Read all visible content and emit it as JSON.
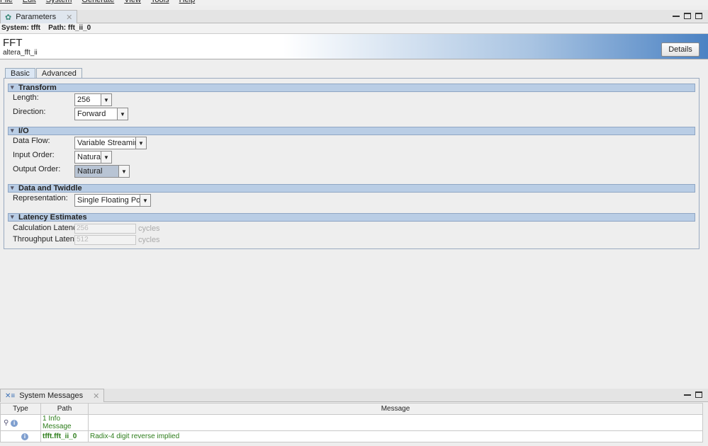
{
  "menu": [
    "File",
    "Edit",
    "System",
    "Generate",
    "View",
    "Tools",
    "Help"
  ],
  "params_tab": "Parameters",
  "path_bar": {
    "system_label": "System:",
    "system": "tfft",
    "path_label": "Path:",
    "path": "fft_ii_0"
  },
  "header": {
    "title": "FFT",
    "subtitle": "altera_fft_ii",
    "details": "Details"
  },
  "tabs": [
    "Basic",
    "Advanced"
  ],
  "sections": {
    "transform": {
      "title": "Transform",
      "length_label": "Length:",
      "length": "256",
      "direction_label": "Direction:",
      "direction": "Forward"
    },
    "io": {
      "title": "I/O",
      "data_flow_label": "Data Flow:",
      "data_flow": "Variable Streaming",
      "input_order_label": "Input Order:",
      "input_order": "Natural",
      "output_order_label": "Output Order:",
      "output_order": "Natural"
    },
    "data": {
      "title": "Data and Twiddle",
      "rep_label": "Representation:",
      "rep": "Single Floating Point"
    },
    "latency": {
      "title": "Latency Estimates",
      "calc_label": "Calculation Latency:",
      "calc": "256",
      "through_label": "Throughput Latency:",
      "through": "512",
      "unit": "cycles"
    }
  },
  "messages": {
    "tab": "System Messages",
    "cols": [
      "Type",
      "Path",
      "Message"
    ],
    "summary": "1 Info Message",
    "row_path": "tfft.fft_ii_0",
    "row_msg": "Radix-4 digit reverse implied"
  }
}
